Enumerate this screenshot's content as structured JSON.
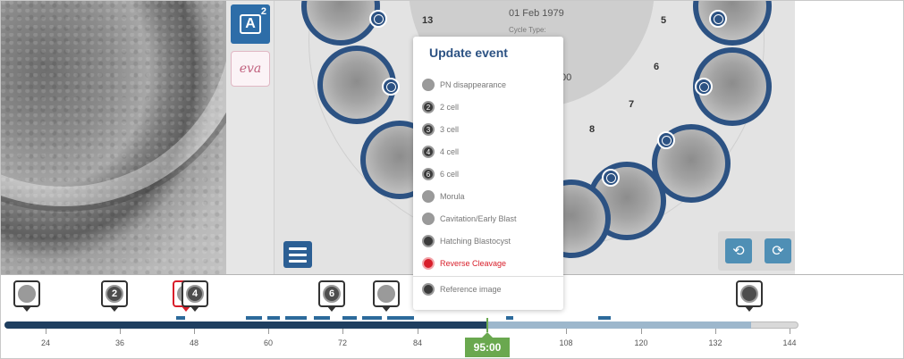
{
  "toolbar": {
    "annotate_letter": "A",
    "annotate_count": "2",
    "expand_icon": "chevron-right-icon",
    "logo_text": "eva"
  },
  "dish": {
    "date": "01 Feb 1979",
    "cycle_type_label": "Cycle Type:",
    "partial_text": "00",
    "well_numbers": [
      "13",
      "5",
      "6",
      "7",
      "8"
    ]
  },
  "popup": {
    "title": "Update event",
    "items": [
      {
        "label": "PN disappearance",
        "icon": "pn-icon"
      },
      {
        "label": "2 cell",
        "icon": "2"
      },
      {
        "label": "3 cell",
        "icon": "3"
      },
      {
        "label": "4 cell",
        "icon": "4"
      },
      {
        "label": "6 cell",
        "icon": "6"
      },
      {
        "label": "Morula",
        "icon": "morula-icon"
      },
      {
        "label": "Cavitation/Early Blast",
        "icon": "blast-icon"
      },
      {
        "label": "Hatching Blastocyst",
        "icon": "hatching-icon"
      },
      {
        "label": "Reverse Cleavage",
        "icon": "reverse-icon"
      },
      {
        "label": "Reference image",
        "icon": "camera-icon"
      }
    ]
  },
  "timeline": {
    "markers": [
      "",
      "2",
      "",
      "4",
      "6",
      "",
      ""
    ],
    "ticks": [
      "24",
      "36",
      "48",
      "60",
      "72",
      "84",
      "108",
      "120",
      "132",
      "144"
    ],
    "cursor": "95:00"
  },
  "colors": {
    "accent": "#2c5283",
    "cursor": "#6aa84f",
    "danger": "#d81e2a"
  }
}
